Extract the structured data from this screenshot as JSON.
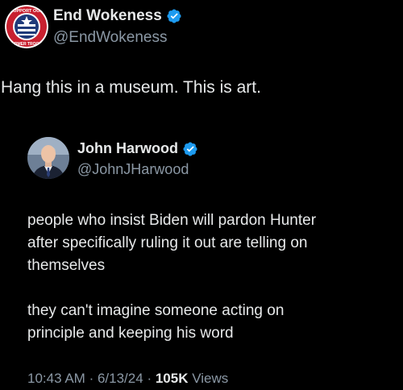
{
  "outer_tweet": {
    "display_name": "End Wokeness",
    "handle": "@EndWokeness",
    "text": "Hang this in a museum. This is art.",
    "avatar_icon": "support-our-former-troops-emblem-icon",
    "avatar_badge_text_top": "SUPPORT OUR",
    "avatar_badge_text_bottom": "FORMER TROOPS",
    "verified_icon": "verified-badge-icon"
  },
  "quoted_tweet": {
    "display_name": "John Harwood",
    "handle": "@JohnJHarwood",
    "paragraphs": [
      [
        "people who insist Biden will pardon Hunter",
        "after specifically ruling it out are telling on",
        "themselves"
      ],
      [
        "they can't imagine someone acting on",
        "principle and keeping his word"
      ]
    ],
    "avatar_icon": "profile-photo-icon",
    "verified_icon": "verified-badge-icon"
  },
  "meta": {
    "time": "10:43 AM",
    "separator": "·",
    "date": "6/13/24",
    "views_count": "105K",
    "views_label": "Views"
  },
  "colors": {
    "background": "#000000",
    "text_primary": "#e7e9ea",
    "text_secondary": "#8b98a5",
    "verified_blue": "#1d9bf0"
  }
}
